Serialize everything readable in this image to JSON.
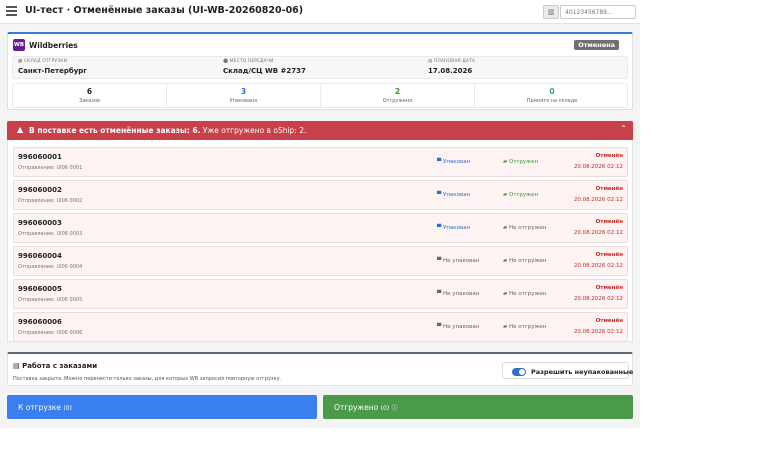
{
  "header": {
    "title": "UI-тест · Отменённые заказы (UI-WB-20260820-06)",
    "scan_placeholder": "40123456789..."
  },
  "shipment": {
    "brand": "Wildberries",
    "brand_abbr": "WB",
    "status": "Отменена",
    "warehouse_label": "СКЛАД ОТГРУЗКИ",
    "warehouse": "Санкт-Петербург",
    "handover_label": "МЕСТО ПЕРЕДАЧИ",
    "handover": "Склад/СЦ WB #2737",
    "date_label": "ПЛАНОВАЯ ДАТА",
    "date": "17.08.2026",
    "stats": [
      {
        "value": "6",
        "label": "Заказов",
        "color": "#222222"
      },
      {
        "value": "3",
        "label": "Упаковано",
        "color": "#2a6fd1"
      },
      {
        "value": "2",
        "label": "Отгружено",
        "color": "#3a9a3a"
      },
      {
        "value": "0",
        "label": "Принято на складе",
        "color": "#2a9d8f"
      }
    ]
  },
  "alert": {
    "bold": "В поставке есть отменённые заказы: 6.",
    "rest": " Уже отгружено в oShip: 2.",
    "color": "#c8404a"
  },
  "orders": [
    {
      "number": "996060001",
      "sub": "Отправление: UI06 0001",
      "pack": "Упакован",
      "pack_ok": true,
      "ship": "Отгружен",
      "ship_ok": true,
      "cancel": "Отменён",
      "date": "20.08.2026 02:12"
    },
    {
      "number": "996060002",
      "sub": "Отправление: UI06 0002",
      "pack": "Упакован",
      "pack_ok": true,
      "ship": "Отгружен",
      "ship_ok": true,
      "cancel": "Отменён",
      "date": "20.08.2026 02:12"
    },
    {
      "number": "996060003",
      "sub": "Отправление: UI06 0003",
      "pack": "Упакован",
      "pack_ok": true,
      "ship": "Не отгружен",
      "ship_ok": false,
      "cancel": "Отменён",
      "date": "20.08.2026 02:12"
    },
    {
      "number": "996060004",
      "sub": "Отправление: UI06 0004",
      "pack": "Не упакован",
      "pack_ok": false,
      "ship": "Не отгружен",
      "ship_ok": false,
      "cancel": "Отменён",
      "date": "20.08.2026 02:12"
    },
    {
      "number": "996060005",
      "sub": "Отправление: UI06 0005",
      "pack": "Не упакован",
      "pack_ok": false,
      "ship": "Не отгружен",
      "ship_ok": false,
      "cancel": "Отменён",
      "date": "20.08.2026 02:12"
    },
    {
      "number": "996060006",
      "sub": "Отправление: UI06 0006",
      "pack": "Не упакован",
      "pack_ok": false,
      "ship": "Не отгружен",
      "ship_ok": false,
      "cancel": "Отменён",
      "date": "20.08.2026 02:12"
    }
  ],
  "work": {
    "title": "Работа с заказами",
    "desc": "Поставка закрыта. Можно перенести только заказы, для которых WB запросил повторную отгрузку.",
    "toggle_label": "Разрешить неупакованные",
    "toggle_on": true
  },
  "actions": {
    "to_ship_label": "К отгрузке",
    "to_ship_count": "(0)",
    "shipped_label": "Отгружено",
    "shipped_count": "(0)"
  }
}
